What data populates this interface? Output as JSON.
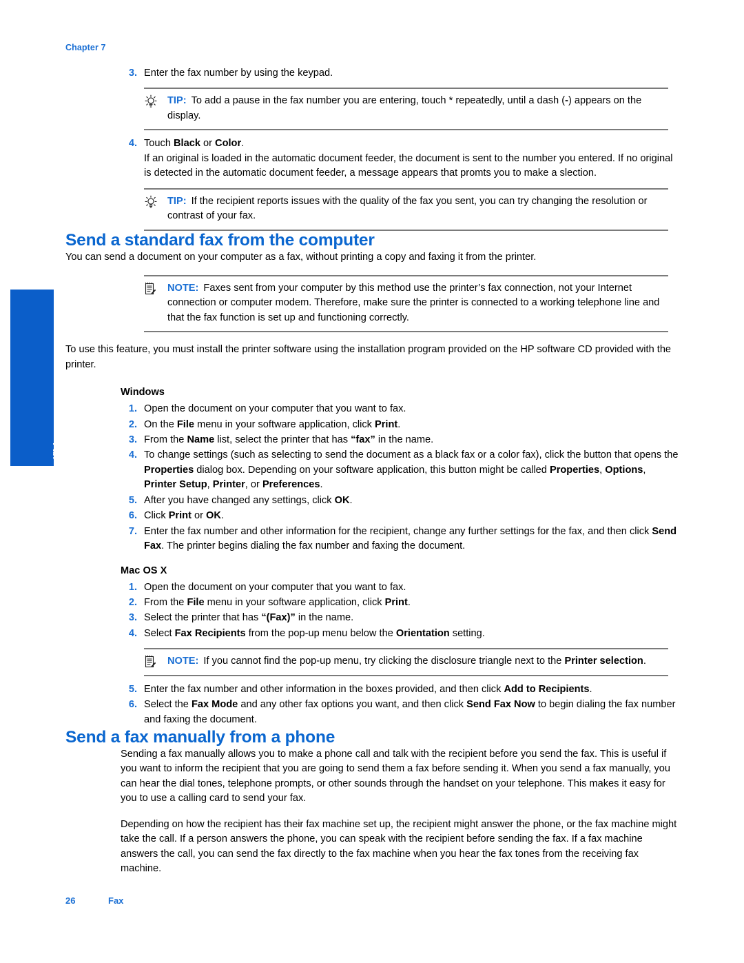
{
  "page": {
    "chapter_label": "Chapter 7",
    "footer_page_number": "26",
    "footer_section": "Fax",
    "side_tab_label": "Fax",
    "accent_blue": "#1a6fd4",
    "heading_blue": "#0a66cf",
    "tab_blue": "#0b5ec9"
  },
  "top_steps": {
    "step3": {
      "num": "3.",
      "text": "Enter the fax number by using the keypad."
    },
    "tip1": {
      "icon": "lightbulb-icon",
      "keyword": "TIP:",
      "text_a": "To add a pause in the fax number you are entering, touch * repeatedly, until a dash (",
      "text_b": "-",
      "text_c": ") appears on the display."
    },
    "step4": {
      "num": "4.",
      "lead_a": "Touch ",
      "bold_black": "Black",
      "lead_b": " or ",
      "bold_color": "Color",
      "lead_c": ".",
      "body": "If an original is loaded in the automatic document feeder, the document is sent to the number you entered. If no original is detected in the automatic document feeder, a message appears that promts you to make a slection."
    },
    "tip2": {
      "icon": "lightbulb-icon",
      "keyword": "TIP:",
      "text": "If the recipient reports issues with the quality of the fax you sent, you can try changing the resolution or contrast of your fax."
    }
  },
  "section_computer": {
    "title": "Send a standard fax from the computer",
    "intro": "You can send a document on your computer as a fax, without printing a copy and faxing it from the printer.",
    "note": {
      "icon": "note-pad-icon",
      "keyword": "NOTE:",
      "text": "Faxes sent from your computer by this method use the printer’s fax connection, not your Internet connection or computer modem. Therefore, make sure the printer is connected to a working telephone line and that the fax function is set up and functioning correctly."
    },
    "requirement": "To use this feature, you must install the printer software using the installation program provided on the HP software CD provided with the printer.",
    "windows_heading": "Windows",
    "windows_steps": [
      {
        "num": "1.",
        "parts": [
          {
            "t": "Open the document on your computer that you want to fax.",
            "b": false
          }
        ]
      },
      {
        "num": "2.",
        "parts": [
          {
            "t": "On the ",
            "b": false
          },
          {
            "t": "File",
            "b": true
          },
          {
            "t": " menu in your software application, click ",
            "b": false
          },
          {
            "t": "Print",
            "b": true
          },
          {
            "t": ".",
            "b": false
          }
        ]
      },
      {
        "num": "3.",
        "parts": [
          {
            "t": "From the ",
            "b": false
          },
          {
            "t": "Name",
            "b": true
          },
          {
            "t": " list, select the printer that has ",
            "b": false
          },
          {
            "t": "“fax”",
            "b": true
          },
          {
            "t": " in the name.",
            "b": false
          }
        ]
      },
      {
        "num": "4.",
        "parts": [
          {
            "t": "To change settings (such as selecting to send the document as a black fax or a color fax), click the button that opens the ",
            "b": false
          },
          {
            "t": "Properties",
            "b": true
          },
          {
            "t": " dialog box. Depending on your software application, this button might be called ",
            "b": false
          },
          {
            "t": "Properties",
            "b": true
          },
          {
            "t": ", ",
            "b": false
          },
          {
            "t": "Options",
            "b": true
          },
          {
            "t": ", ",
            "b": false
          },
          {
            "t": "Printer Setup",
            "b": true
          },
          {
            "t": ", ",
            "b": false
          },
          {
            "t": "Printer",
            "b": true
          },
          {
            "t": ", or ",
            "b": false
          },
          {
            "t": "Preferences",
            "b": true
          },
          {
            "t": ".",
            "b": false
          }
        ]
      },
      {
        "num": "5.",
        "parts": [
          {
            "t": "After you have changed any settings, click ",
            "b": false
          },
          {
            "t": "OK",
            "b": true
          },
          {
            "t": ".",
            "b": false
          }
        ]
      },
      {
        "num": "6.",
        "parts": [
          {
            "t": "Click ",
            "b": false
          },
          {
            "t": "Print",
            "b": true
          },
          {
            "t": " or ",
            "b": false
          },
          {
            "t": "OK",
            "b": true
          },
          {
            "t": ".",
            "b": false
          }
        ]
      },
      {
        "num": "7.",
        "parts": [
          {
            "t": "Enter the fax number and other information for the recipient, change any further settings for the fax, and then click ",
            "b": false
          },
          {
            "t": "Send Fax",
            "b": true
          },
          {
            "t": ". The printer begins dialing the fax number and faxing the document.",
            "b": false
          }
        ]
      }
    ],
    "mac_heading": "Mac OS X",
    "mac_steps_before_note": [
      {
        "num": "1.",
        "parts": [
          {
            "t": "Open the document on your computer that you want to fax.",
            "b": false
          }
        ]
      },
      {
        "num": "2.",
        "parts": [
          {
            "t": "From the ",
            "b": false
          },
          {
            "t": "File",
            "b": true
          },
          {
            "t": " menu in your software application, click ",
            "b": false
          },
          {
            "t": "Print",
            "b": true
          },
          {
            "t": ".",
            "b": false
          }
        ]
      },
      {
        "num": "3.",
        "parts": [
          {
            "t": "Select the printer that has ",
            "b": false
          },
          {
            "t": "“(Fax)”",
            "b": true
          },
          {
            "t": " in the name.",
            "b": false
          }
        ]
      },
      {
        "num": "4.",
        "parts": [
          {
            "t": "Select ",
            "b": false
          },
          {
            "t": "Fax Recipients",
            "b": true
          },
          {
            "t": " from the pop-up menu below the ",
            "b": false
          },
          {
            "t": "Orientation",
            "b": true
          },
          {
            "t": " setting.",
            "b": false
          }
        ]
      }
    ],
    "mac_note": {
      "icon": "note-pad-icon",
      "keyword": "NOTE:",
      "text_a": "If you cannot find the pop-up menu, try clicking the disclosure triangle next to the ",
      "bold_b": "Printer selection",
      "text_c": "."
    },
    "mac_steps_after_note": [
      {
        "num": "5.",
        "parts": [
          {
            "t": "Enter the fax number and other information in the boxes provided, and then click ",
            "b": false
          },
          {
            "t": "Add to Recipients",
            "b": true
          },
          {
            "t": ".",
            "b": false
          }
        ]
      },
      {
        "num": "6.",
        "parts": [
          {
            "t": "Select the ",
            "b": false
          },
          {
            "t": "Fax Mode",
            "b": true
          },
          {
            "t": " and any other fax options you want, and then click ",
            "b": false
          },
          {
            "t": "Send Fax Now",
            "b": true
          },
          {
            "t": " to begin dialing the fax number and faxing the document.",
            "b": false
          }
        ]
      }
    ]
  },
  "section_phone": {
    "title": "Send a fax manually from a phone",
    "paragraph_1": "Sending a fax manually allows you to make a phone call and talk with the recipient before you send the fax. This is useful if you want to inform the recipient that you are going to send them a fax before sending it. When you send a fax manually, you can hear the dial tones, telephone prompts, or other sounds through the handset on your telephone. This makes it easy for you to use a calling card to send your fax.",
    "paragraph_2": "Depending on how the recipient has their fax machine set up, the recipient might answer the phone, or the fax machine might take the call. If a person answers the phone, you can speak with the recipient before sending the fax. If a fax machine answers the call, you can send the fax directly to the fax machine when you hear the fax tones from the receiving fax machine."
  }
}
